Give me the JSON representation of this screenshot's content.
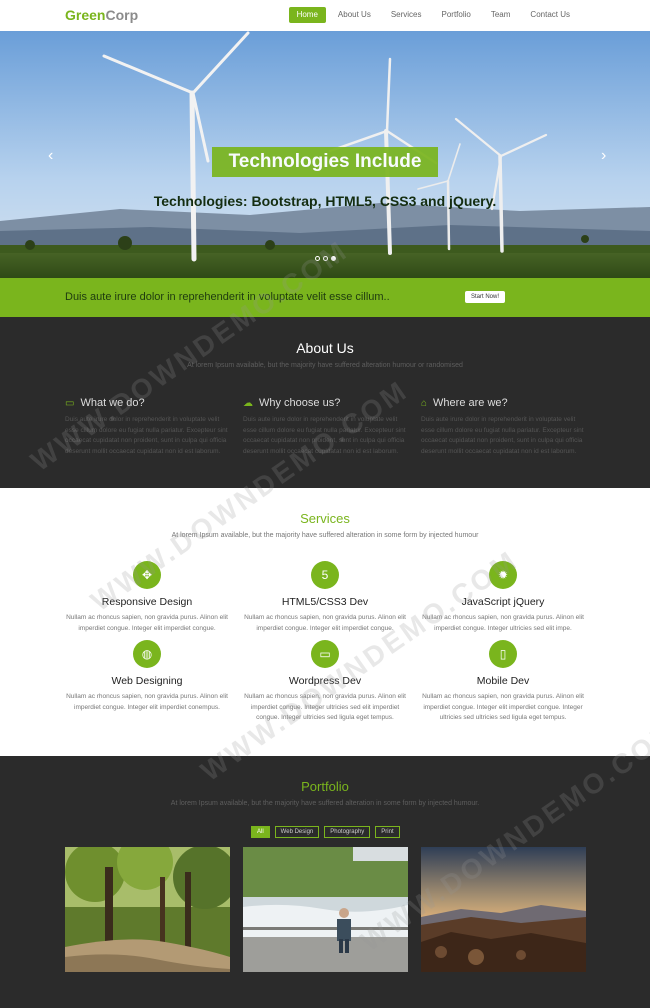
{
  "nav": {
    "logo_green": "Green",
    "logo_gray": "Corp",
    "items": [
      {
        "label": "Home"
      },
      {
        "label": "About Us"
      },
      {
        "label": "Services"
      },
      {
        "label": "Portfolio"
      },
      {
        "label": "Team"
      },
      {
        "label": "Contact Us"
      }
    ]
  },
  "hero": {
    "title": "Technologies Include",
    "subtitle": "Technologies: Bootstrap, HTML5, CSS3 and jQuery.",
    "prev_arrow": "‹",
    "next_arrow": "›"
  },
  "cta": {
    "text": "Duis aute irure dolor in reprehenderit in voluptate velit esse cillum..",
    "button": "Start Now!"
  },
  "about": {
    "title": "About Us",
    "lead": "At lorem Ipsum available, but the majority have suffered alteration humour or randomised",
    "columns": [
      {
        "icon": "monitor-icon",
        "glyph": "▭",
        "title": "What we do?",
        "text": "Duis aute irure dolor in reprehenderit in voluptate velit esse cillum dolore eu fugiat nulla pariatur. Excepteur sint occaecat cupidatat non proident, sunt in culpa qui officia deserunt mollit occaecat cupidatat non id est laborum."
      },
      {
        "icon": "cloud-icon",
        "glyph": "☁",
        "title": "Why choose us?",
        "text": "Duis aute irure dolor in reprehenderit in voluptate velit esse cillum dolore eu fugiat nulla pariatur. Excepteur sint occaecat cupidatat non proident, sunt in culpa qui officia deserunt mollit occaecat cupidatat non id est laborum."
      },
      {
        "icon": "home-icon",
        "glyph": "⌂",
        "title": "Where are we?",
        "text": "Duis aute irure dolor in reprehenderit in voluptate velit esse cillum dolore eu fugiat nulla pariatur. Excepteur sint occaecat cupidatat non proident, sunt in culpa qui officia deserunt mollit occaecat cupidatat non id est laborum."
      }
    ]
  },
  "services": {
    "title": "Services",
    "lead": "At lorem Ipsum available, but the majority have suffered alteration in some form by injected humour",
    "items": [
      {
        "icon": "move-icon",
        "glyph": "✥",
        "title": "Responsive Design",
        "text": "Nullam ac rhoncus sapien, non gravida purus. Alinon elit imperdiet congue. Integer elit imperdiet congue."
      },
      {
        "icon": "html5-icon",
        "glyph": "5",
        "title": "HTML5/CSS3 Dev",
        "text": "Nullam ac rhoncus sapien, non gravida purus. Alinon elit imperdiet congue. Integer elit imperdiet congue."
      },
      {
        "icon": "lightbulb-icon",
        "glyph": "✹",
        "title": "JavaScript jQuery",
        "text": "Nullam ac rhoncus sapien, non gravida purus. Alinon elit imperdiet congue. Integer ultricies sed elit impe."
      },
      {
        "icon": "globe-icon",
        "glyph": "◍",
        "title": "Web Designing",
        "text": "Nullam ac rhoncus sapien, non gravida purus. Alinon elit imperdiet congue. Integer elit imperdiet conempus."
      },
      {
        "icon": "desktop-icon",
        "glyph": "▭",
        "title": "Wordpress Dev",
        "text": "Nullam ac rhoncus sapien, non gravida purus. Alinon elit imperdiet congue. Integer ultricies sed elit imperdiet congue. Integer ultricies sed ligula eget tempus."
      },
      {
        "icon": "mobile-icon",
        "glyph": "▯",
        "title": "Mobile Dev",
        "text": "Nullam ac rhoncus sapien, non gravida purus. Alinon elit imperdiet congue. Integer elit imperdiet congue. Integer ultricies sed ultricies sed ligula eget tempus."
      }
    ]
  },
  "portfolio": {
    "title": "Portfolio",
    "lead": "At lorem Ipsum available, but the majority have suffered alteration in some form by injected humour.",
    "filters": [
      "All",
      "Web Design",
      "Photography",
      "Print"
    ]
  },
  "watermark": "WWW.DOWNDEMO.COM",
  "colors": {
    "accent": "#7ab51d",
    "dark": "#2b2b2b"
  }
}
